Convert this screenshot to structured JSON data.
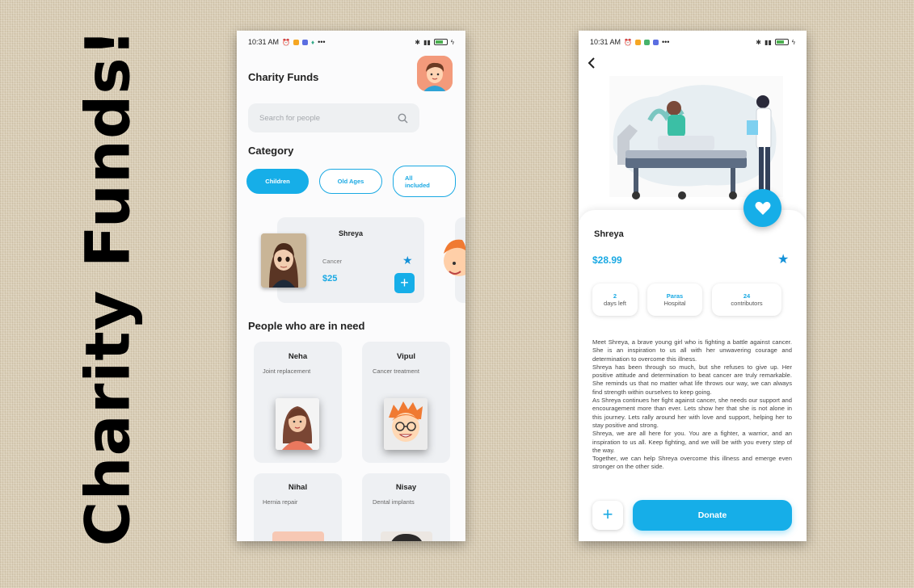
{
  "brand_color": "#16aee8",
  "slide_title": "Charity Funds!",
  "status_bar": {
    "time": "10:31 AM",
    "dots": "•••",
    "battery": "31"
  },
  "home": {
    "title": "Charity Funds",
    "search_placeholder": "Search for people",
    "category_heading": "Category",
    "categories": [
      {
        "label": "Children",
        "active": true
      },
      {
        "label": "Old Ages",
        "active": false
      },
      {
        "label": "All included",
        "active": false
      }
    ],
    "featured": {
      "name": "Shreya",
      "condition": "Cancer",
      "amount": "$25"
    },
    "people_heading": "People who are in need",
    "people": [
      {
        "name": "Neha",
        "need": "Joint replacement"
      },
      {
        "name": "Vipul",
        "need": "Cancer treatment"
      },
      {
        "name": "Nihal",
        "need": "Hernia repair"
      },
      {
        "name": "Nisay",
        "need": "Dental implants"
      }
    ]
  },
  "detail": {
    "name": "Shreya",
    "amount": "$28.99",
    "stats": [
      {
        "value": "2",
        "label": "days left"
      },
      {
        "value": "Paras",
        "label": "Hospital"
      },
      {
        "value": "24",
        "label": "contributors"
      }
    ],
    "story": [
      "Meet Shreya, a brave young girl who is fighting a battle against cancer. She is an inspiration to us all with her unwavering courage and determination to overcome this illness.",
      "Shreya has been through so much, but she refuses to give up. Her positive attitude and determination to beat cancer are truly remarkable. She reminds us that no matter what life throws our way, we can always find strength within ourselves to keep going.",
      " As Shreya continues her fight against cancer, she needs our support and encouragement more than ever. Lets show her that she is not alone in this journey. Lets rally around her with love and support, helping her to stay positive and strong.",
      " Shreya, we are all here for you. You are a fighter, a warrior, and an inspiration to us all. Keep fighting, and we will be with you every step of the way.",
      " Together, we can help Shreya overcome this illness and emerge even stronger on the other side."
    ],
    "donate_label": "Donate",
    "add_label": "+"
  }
}
